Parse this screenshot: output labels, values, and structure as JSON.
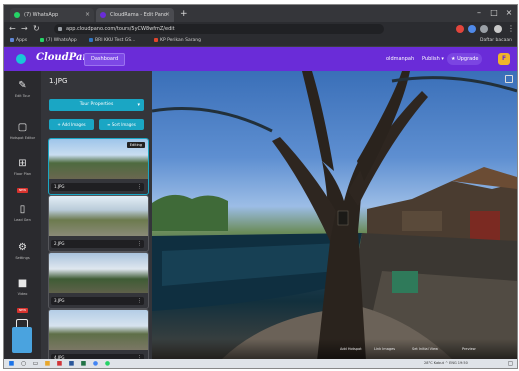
{
  "browser": {
    "tabs": [
      {
        "title": "(7) WhatsApp",
        "favicon_color": "#25d366"
      },
      {
        "title": "CloudRama - Edit Pano",
        "favicon_color": "#6a2cd8"
      }
    ],
    "new_tab_icon": "plus-icon",
    "url": "app.cloudpano.com/tours/5yCW8wfmZ/edit",
    "bookmarks": [
      {
        "label": "Apps",
        "color": "#5f86d6"
      },
      {
        "label": "(7) WhatsApp",
        "color": "#25d366"
      },
      {
        "label": "BRI KKU Test GS...",
        "color": "#2f74c0"
      },
      {
        "label": "KP Perikan Sarang",
        "color": "#e0452d"
      }
    ],
    "reading_list": "Daftar bacaan"
  },
  "app": {
    "logo": "CloudPano",
    "dashboard_button": "Dashboard",
    "username": "oldmanpah",
    "publish": "Publish",
    "upgrade": "Upgrade",
    "avatar_letter": "F",
    "brand_color": "#6a2cd8",
    "accent_color": "#1aa6c4"
  },
  "rail": [
    {
      "icon": "pencil-icon",
      "label": "Edit Tour",
      "glyph": "✎"
    },
    {
      "icon": "window-icon",
      "label": "Hotspot Editor",
      "glyph": "▢",
      "badge": ""
    },
    {
      "icon": "floorplan-icon",
      "label": "Floor Plan",
      "glyph": "⊞",
      "badge": "NEW"
    },
    {
      "icon": "device-icon",
      "label": "Lead Gen",
      "glyph": "▯"
    },
    {
      "icon": "gear-icon",
      "label": "Settings",
      "glyph": "⚙"
    },
    {
      "icon": "video-icon",
      "label": "Video",
      "glyph": "■",
      "badge": "NEW"
    }
  ],
  "panel": {
    "title": "1.JPG",
    "primary_button": "Tour Properties",
    "add_images": "+ Add Images",
    "sort_images": "≡ Sort Images",
    "thumbnails": [
      {
        "name": "1.JPG",
        "tag": "Editing"
      },
      {
        "name": "2.JPG",
        "tag": ""
      },
      {
        "name": "3.JPG",
        "tag": ""
      },
      {
        "name": "4.JPG",
        "tag": ""
      }
    ]
  },
  "viewer": {
    "controls": [
      "Add Hotspot",
      "Link Images",
      "Set Initial View",
      "Preview"
    ]
  },
  "taskbar": {
    "tray_text": "28°C Kabut  ^  ENG  19:50"
  }
}
